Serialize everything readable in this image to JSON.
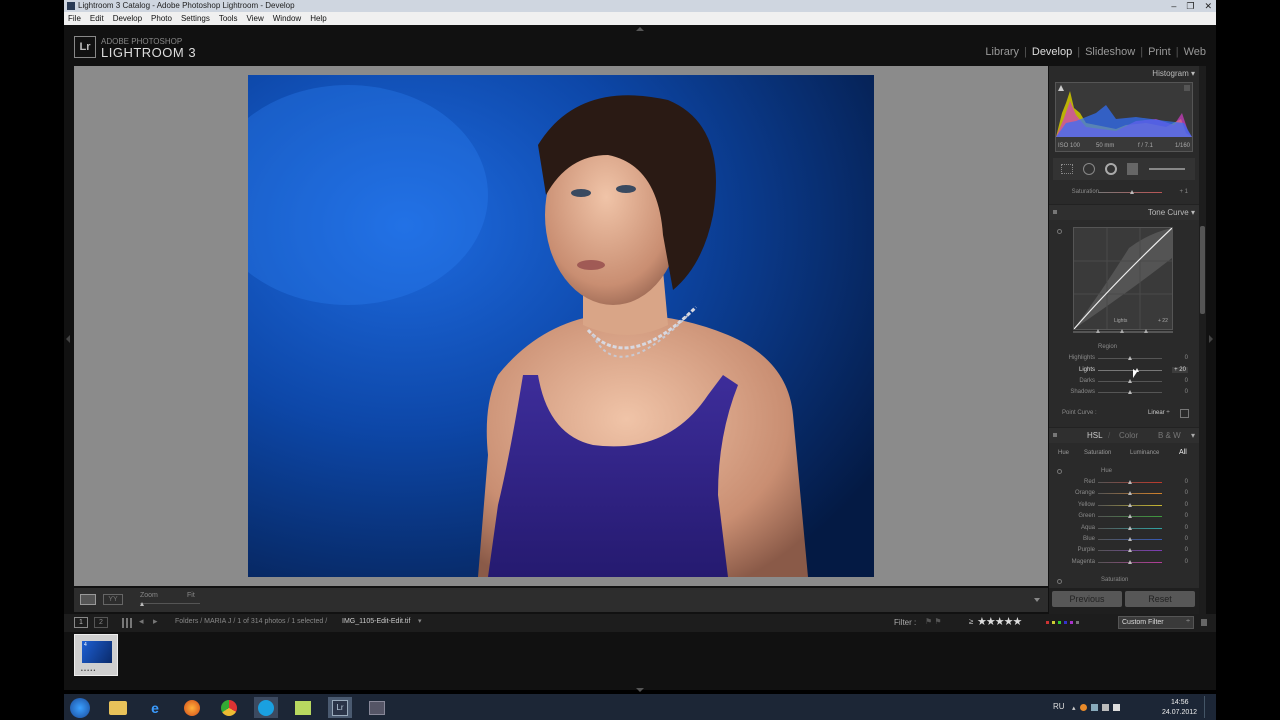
{
  "window": {
    "title": "Lightroom 3 Catalog - Adobe Photoshop Lightroom - Develop",
    "controls": [
      "–",
      "❐",
      "✕"
    ]
  },
  "menu": [
    "File",
    "Edit",
    "Develop",
    "Photo",
    "Settings",
    "Tools",
    "View",
    "Window",
    "Help"
  ],
  "identity": {
    "logo": "Lr",
    "product_small": "ADOBE PHOTOSHOP",
    "product_big": "LIGHTROOM 3"
  },
  "modules": [
    {
      "label": "Library",
      "active": false
    },
    {
      "label": "Develop",
      "active": true
    },
    {
      "label": "Slideshow",
      "active": false
    },
    {
      "label": "Print",
      "active": false
    },
    {
      "label": "Web",
      "active": false
    }
  ],
  "toolbar": {
    "zoom_label": "Zoom",
    "zoom_value": "Fit"
  },
  "histogram": {
    "title": "Histogram",
    "iso": "ISO 100",
    "focal": "50 mm",
    "aperture": "f / 7.1",
    "shutter": "1/160"
  },
  "saturation_row": {
    "label": "Saturation",
    "value": "+ 1",
    "level": 0.5
  },
  "tone_curve": {
    "title": "Tone Curve",
    "region_label": "Region",
    "curve_badge_label": "Lights",
    "curve_badge_value": "+ 22",
    "sliders": [
      {
        "label": "Highlights",
        "value": "0",
        "level": 0.5,
        "active": false
      },
      {
        "label": "Lights",
        "value": "+ 20",
        "level": 0.6,
        "active": true
      },
      {
        "label": "Darks",
        "value": "0",
        "level": 0.5,
        "active": false
      },
      {
        "label": "Shadows",
        "value": "0",
        "level": 0.5,
        "active": false
      }
    ],
    "point_curve_label": "Point Curve :",
    "point_curve_value": "Linear ÷"
  },
  "hsl": {
    "title_hsl": "HSL",
    "title_sep": "/",
    "title_color": "Color",
    "title_bw": "B & W",
    "tabs": [
      "Hue",
      "Saturation",
      "Luminance",
      "All"
    ],
    "active_tab": "All",
    "hue_label": "Hue",
    "saturation_label": "Saturation",
    "sliders": [
      {
        "label": "Red",
        "value": "0",
        "level": 0.5,
        "color": "#c0392b"
      },
      {
        "label": "Orange",
        "value": "0",
        "level": 0.5,
        "color": "#d4822a"
      },
      {
        "label": "Yellow",
        "value": "0",
        "level": 0.5,
        "color": "#c9b830"
      },
      {
        "label": "Green",
        "value": "0",
        "level": 0.5,
        "color": "#3d9a3d"
      },
      {
        "label": "Aqua",
        "value": "0",
        "level": 0.5,
        "color": "#2fa3a3"
      },
      {
        "label": "Blue",
        "value": "0",
        "level": 0.5,
        "color": "#3559b5"
      },
      {
        "label": "Purple",
        "value": "0",
        "level": 0.5,
        "color": "#7d3cb5"
      },
      {
        "label": "Magenta",
        "value": "0",
        "level": 0.5,
        "color": "#b53c9a"
      }
    ]
  },
  "panel_buttons": {
    "previous": "Previous",
    "reset": "Reset"
  },
  "filmstrip": {
    "view1": "1",
    "view2": "2",
    "breadcrumb": "Folders / MARIA J / 1 of 314 photos / 1 selected /",
    "filename": "IMG_1105-Edit-Edit.tif",
    "filter_label": "Filter :",
    "rating_op": "≥",
    "stars": "★★★★★",
    "custom_filter": "Custom Filter",
    "thumb_badge": "4",
    "thumb_stars": "• • • • •"
  },
  "taskbar": {
    "lang": "RU",
    "time": "14:56",
    "date": "24.07.2012"
  },
  "colors": {
    "accent_active": "#dddddd",
    "panel_bg": "#2a2a2a",
    "canvas_bg": "#8b8b8b"
  }
}
